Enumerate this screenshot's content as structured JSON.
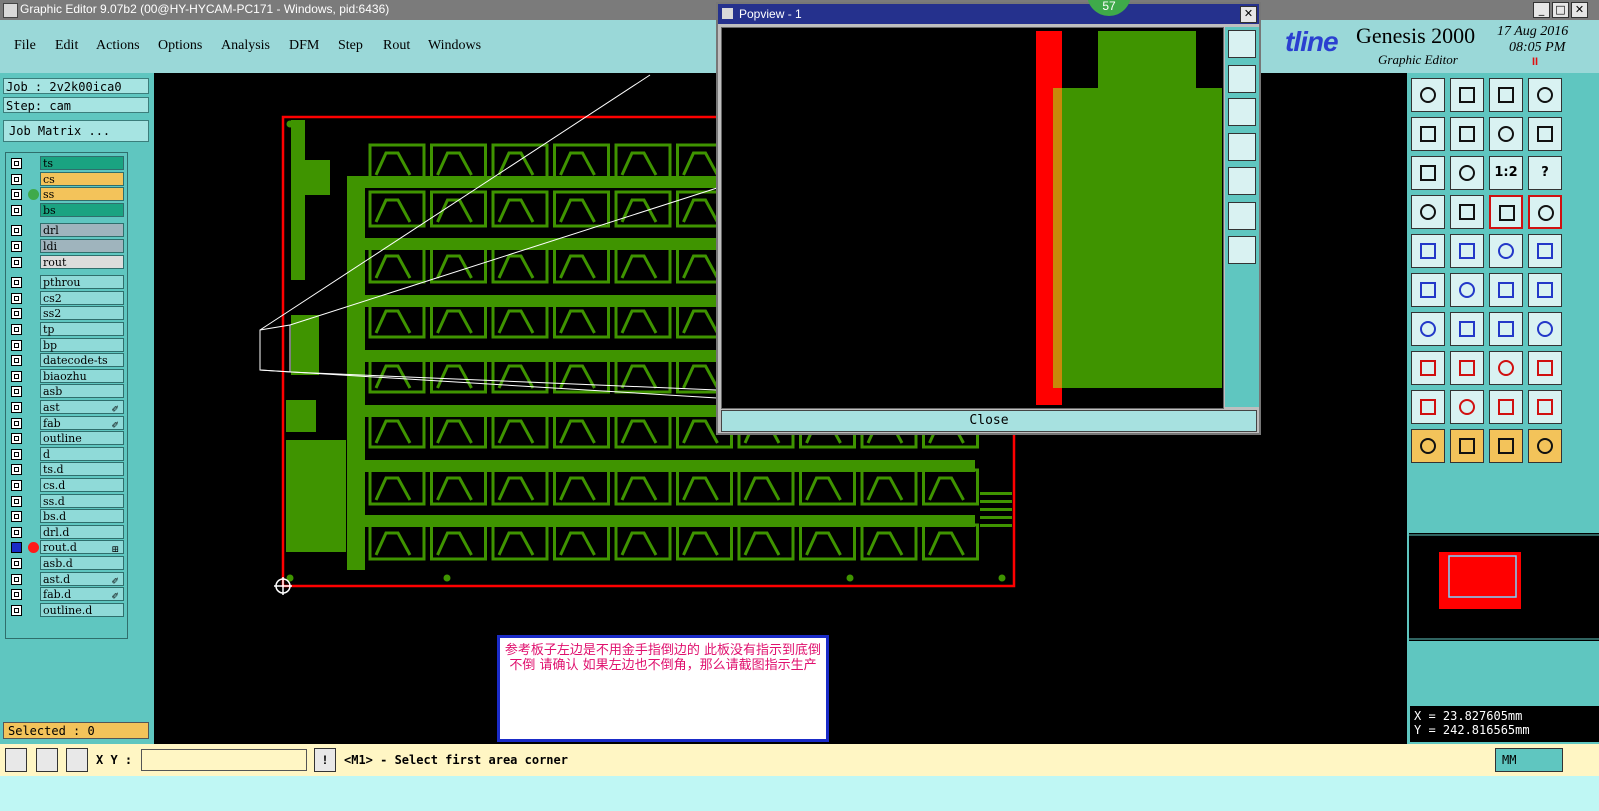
{
  "window": {
    "title": "Graphic Editor 9.07b2 (00@HY-HYCAM-PC171 - Windows, pid:6436)",
    "minimize": "_",
    "maximize": "□",
    "close": "✕"
  },
  "menu": [
    "File",
    "Edit",
    "Actions",
    "Options",
    "Analysis",
    "DFM",
    "Step",
    "Rout",
    "Windows"
  ],
  "brand": {
    "logo_word": "tline",
    "product": "Genesis 2000",
    "subtitle": "Graphic Editor",
    "date": "17 Aug 2016",
    "time": "08:05 PM",
    "alert": "II"
  },
  "job": {
    "job_label": "Job : 2v2k00ica0",
    "step_label": "Step: cam",
    "matrix_button": "Job Matrix ..."
  },
  "layers": [
    {
      "name": "ts",
      "color": "#1aa381",
      "group": 0
    },
    {
      "name": "cs",
      "color": "#f3c35a",
      "group": 0
    },
    {
      "name": "ss",
      "color": "#f3c35a",
      "group": 0,
      "dot": "#3faa4a"
    },
    {
      "name": "bs",
      "color": "#1aa381",
      "group": 0
    },
    {
      "name": "drl",
      "color": "#9fb4bd",
      "group": 1
    },
    {
      "name": "ldi",
      "color": "#9fb4bd",
      "group": 1
    },
    {
      "name": "rout",
      "color": "#dcdcdc",
      "group": 1
    },
    {
      "name": "pthrou",
      "color": "#8fdad8",
      "group": 2
    },
    {
      "name": "cs2",
      "color": "#8fdad8",
      "group": 2
    },
    {
      "name": "ss2",
      "color": "#8fdad8",
      "group": 2
    },
    {
      "name": "tp",
      "color": "#8fdad8",
      "group": 2
    },
    {
      "name": "bp",
      "color": "#8fdad8",
      "group": 2
    },
    {
      "name": "datecode-ts",
      "color": "#8fdad8",
      "group": 2
    },
    {
      "name": "biaozhu",
      "color": "#8fdad8",
      "group": 2
    },
    {
      "name": "asb",
      "color": "#8fdad8",
      "group": 2
    },
    {
      "name": "ast",
      "color": "#8fdad8",
      "group": 2,
      "flag": "✐"
    },
    {
      "name": "fab",
      "color": "#8fdad8",
      "group": 2,
      "flag": "✐"
    },
    {
      "name": "outline",
      "color": "#8fdad8",
      "group": 2
    },
    {
      "name": "d",
      "color": "#8fdad8",
      "group": 2
    },
    {
      "name": "ts.d",
      "color": "#8fdad8",
      "group": 2
    },
    {
      "name": "cs.d",
      "color": "#8fdad8",
      "group": 2
    },
    {
      "name": "ss.d",
      "color": "#8fdad8",
      "group": 2
    },
    {
      "name": "bs.d",
      "color": "#8fdad8",
      "group": 2
    },
    {
      "name": "drl.d",
      "color": "#8fdad8",
      "group": 2
    },
    {
      "name": "rout.d",
      "color": "#8fdad8",
      "group": 2,
      "dot": "#ff1a1a",
      "flag": "⊞",
      "checked": true
    },
    {
      "name": "asb.d",
      "color": "#8fdad8",
      "group": 2
    },
    {
      "name": "ast.d",
      "color": "#8fdad8",
      "group": 2,
      "flag": "✐"
    },
    {
      "name": "fab.d",
      "color": "#8fdad8",
      "group": 2,
      "flag": "✐"
    },
    {
      "name": "outline.d",
      "color": "#8fdad8",
      "group": 2
    }
  ],
  "selected_label": "Selected : 0",
  "popview": {
    "title": "Popview - 1",
    "close_button": "Close",
    "badge": "57",
    "close_x": "✕"
  },
  "note": {
    "text": "参考板子左边是不用金手指倒边的 此板没有指示到底倒不倒 请确认 如果左边也不倒角，那么请截图指示生产"
  },
  "coords": {
    "x": "X = 23.827605mm",
    "y": "Y = 242.816565mm"
  },
  "bottom": {
    "xy_label": "X Y :",
    "xy_value": "",
    "warn": "!",
    "prompt": "<M1> - Select first area corner",
    "units": "MM"
  },
  "tool_icons": {
    "1_2": "1:2",
    "help": "?"
  },
  "colors": {
    "copper": "#3f9400",
    "board_outline": "#ff0000",
    "panel": "#5fc6c0",
    "menubar": "#9ad8d8",
    "note_text": "#e0106e"
  }
}
